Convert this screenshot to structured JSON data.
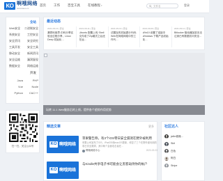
{
  "header": {
    "logo_mark": "KO",
    "logo_name": "啊哦网络",
    "logo_url": "www.kaoo.cc",
    "nav": [
      {
        "label": "首页",
        "caret": false
      },
      {
        "label": "工作",
        "caret": false
      },
      {
        "label": "百宝工具",
        "caret": false
      },
      {
        "label": "在线教程",
        "caret": true
      }
    ],
    "search_placeholder": "文件名",
    "login": "登录"
  },
  "sidebar": {
    "section1_head": "全站",
    "section1_links": [
      "Web安全",
      "二进制安全",
      "系统安全",
      "工控安全",
      "安全资讯",
      "安全研究",
      "工具开发",
      "安全工具",
      "移动安全",
      "新闻资讯",
      "安全运维",
      "漏洞复现",
      "数据安全",
      "网络运维"
    ],
    "section2_head": "开发",
    "section2_links": [
      "Java",
      "PHP",
      "Vue",
      "Node",
      "Python",
      "C&C++"
    ]
  },
  "qr": {
    "caption": "扫一扫，关注公众号"
  },
  "latest": {
    "title": "最近动态",
    "items": [
      {
        "date": "2021-09-13 | 安全",
        "text": "漏洞利用思-中科分享实验全过程分享，Linux Deep 初始化…"
      },
      {
        "date": "2021-09-11 | 安全",
        "text": "Ubuntu 配置上传 Shell 文件成了Zip格式之后还在运…"
      },
      {
        "date": "2021-09-13 | 安全",
        "text": "试题及的初始提示代码-Web在网络网络中的工作代…"
      },
      {
        "date": "2021-09-09 | 安全",
        "text": "Win10 设置了连接中 Windows 下载产品初始化…"
      },
      {
        "date": "2021-09-11 | 安全",
        "text": "Bitlocker 驱动器加密无法达到已有数据访问安全…"
      }
    ]
  },
  "banner": {
    "caption": "玩转 11.1 Web服务后的上线，提供各个趋势作用优势"
  },
  "featured": {
    "title": "精选文章",
    "more": "更多",
    "articles": [
      {
        "thumb_mark": "KO",
        "thumb_name": "啊哦网络",
        "title": "苹果警告称，有3个iOS零日安全漏洞在野外被利用",
        "desc": "苹果公司宣布了iOS、iPadOS和macOS更新，修复了三个在野外被利用的零日安全漏洞，其中两个会使攻击者在…",
        "author": "啊哦网络中心",
        "date": "2023-09-23"
      },
      {
        "thumb_mark": "KO",
        "thumb_name": "啊哦网络",
        "title": "与Kindle共享电子书可能会让黑客劫持你的帐户",
        "desc": "",
        "author": "",
        "date": ""
      }
    ]
  },
  "community": {
    "title": "社区达人",
    "members": [
      "jalbn首席…",
      "Skit",
      "白色",
      "阿白",
      "Stripe"
    ]
  }
}
